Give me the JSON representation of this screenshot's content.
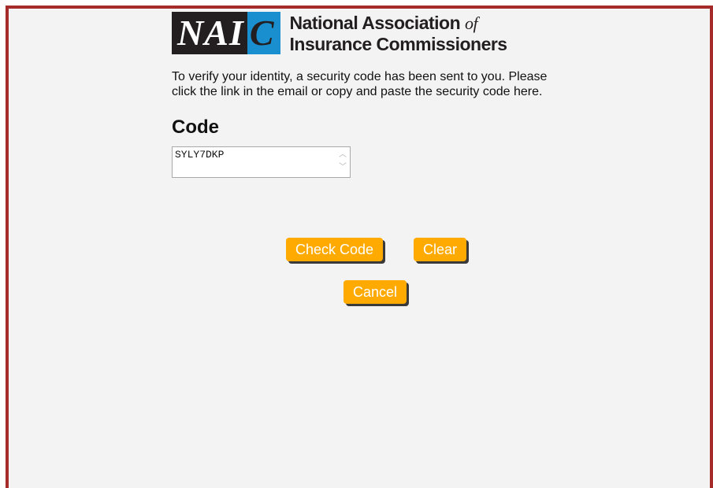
{
  "logo": {
    "mark_left": "NAI",
    "mark_right": "C",
    "line1": "National Association",
    "line1_of": "of",
    "line2": "Insurance Commissioners",
    "colors": {
      "black": "#231f20",
      "blue": "#1a8fd0"
    }
  },
  "intro_text": "To verify your identity, a security code has been sent to you. Please click the link in the email or copy and paste the security code here.",
  "code": {
    "label": "Code",
    "value": "SYLY7DKP"
  },
  "buttons": {
    "check_code": "Check Code",
    "clear": "Clear",
    "cancel": "Cancel"
  },
  "colors": {
    "frame_border": "#a52a2a",
    "button": "#ffaa00"
  }
}
